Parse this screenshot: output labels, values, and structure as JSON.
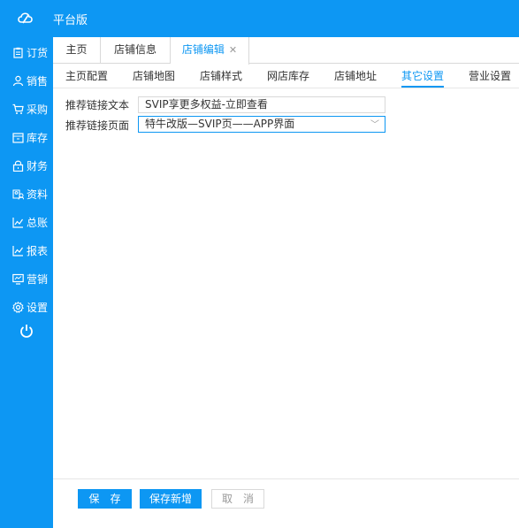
{
  "app": {
    "title": "平台版"
  },
  "sidebar": {
    "items": [
      {
        "label": "订货",
        "icon": "clipboard-icon"
      },
      {
        "label": "销售",
        "icon": "user-icon"
      },
      {
        "label": "采购",
        "icon": "cart-icon"
      },
      {
        "label": "库存",
        "icon": "warehouse-icon"
      },
      {
        "label": "财务",
        "icon": "lock-icon"
      },
      {
        "label": "资料",
        "icon": "profile-icon"
      },
      {
        "label": "总账",
        "icon": "chart-icon"
      },
      {
        "label": "报表",
        "icon": "chart-icon"
      },
      {
        "label": "营销",
        "icon": "monitor-icon"
      },
      {
        "label": "设置",
        "icon": "gear-icon"
      }
    ],
    "power_icon": "power-icon"
  },
  "tabs": [
    {
      "label": "主页"
    },
    {
      "label": "店铺信息"
    },
    {
      "label": "店铺编辑",
      "closable": true,
      "active": true
    }
  ],
  "subnav": {
    "items": [
      "主页配置",
      "店铺地图",
      "店铺样式",
      "网店库存",
      "店铺地址",
      "其它设置",
      "营业设置"
    ],
    "active": "其它设置"
  },
  "form": {
    "link_text_label": "推荐链接文本",
    "link_text_value": "SVIP享更多权益-立即查看",
    "link_page_label": "推荐链接页面",
    "link_page_value": "特牛改版—SVIP页——APP界面"
  },
  "footer": {
    "save": "保　存",
    "save_new": "保存新增",
    "cancel": "取　消"
  },
  "colors": {
    "primary": "#0d97f3"
  }
}
